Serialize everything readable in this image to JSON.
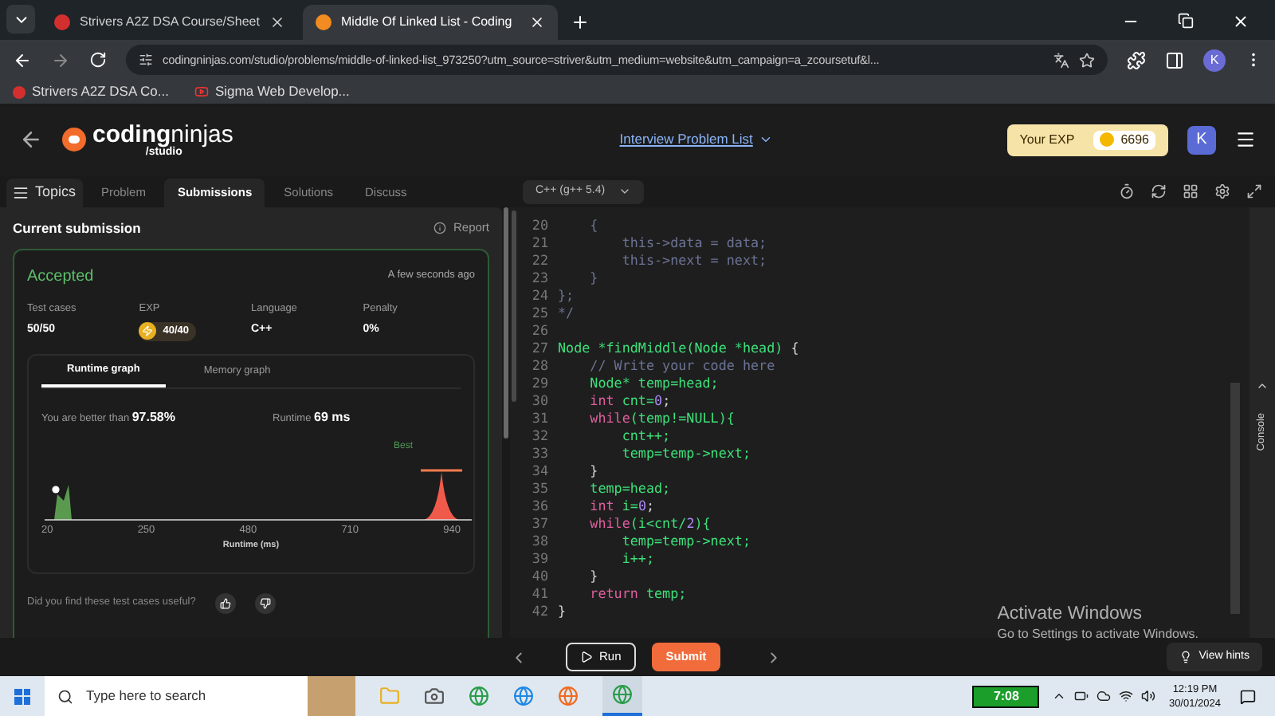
{
  "browser": {
    "tabs": [
      {
        "title": "Strivers A2Z DSA Course/Sheet",
        "selected": false
      },
      {
        "title": "Middle Of Linked List - Coding",
        "selected": true
      }
    ],
    "url": "codingninjas.com/studio/problems/middle-of-linked-list_973250?utm_source=striver&utm_medium=website&utm_campaign=a_zcoursetuf&l...",
    "profile": "K",
    "bookmarks": [
      "Strivers A2Z DSA Co...",
      "Sigma Web Develop..."
    ]
  },
  "header": {
    "logo_main": "coding",
    "logo_accent": "ninjas",
    "logo_sub": "/studio",
    "problem_list": "Interview Problem List",
    "exp_label": "Your EXP",
    "exp_value": "6696",
    "avatar": "K"
  },
  "topics": "Topics",
  "tabs": [
    {
      "label": "Problem",
      "selected": false
    },
    {
      "label": "Submissions",
      "selected": true
    },
    {
      "label": "Solutions",
      "selected": false
    },
    {
      "label": "Discuss",
      "selected": false
    }
  ],
  "submission": {
    "title": "Current submission",
    "report": "Report",
    "status": "Accepted",
    "time": "A few seconds ago",
    "stats": [
      {
        "label": "Test cases",
        "value": "50/50",
        "kind": "text"
      },
      {
        "label": "EXP",
        "value": "40/40",
        "kind": "exp"
      },
      {
        "label": "Language",
        "value": "C++",
        "kind": "text"
      },
      {
        "label": "Penalty",
        "value": "0%",
        "kind": "text"
      }
    ],
    "graph_tabs": [
      {
        "label": "Runtime graph",
        "selected": true
      },
      {
        "label": "Memory graph",
        "selected": false
      }
    ],
    "better": "You are better than **97.58%**",
    "runtime": "Runtime **69 ms**",
    "best": "Best",
    "x_ticks": [
      "20",
      "250",
      "480",
      "710",
      "940"
    ],
    "x_label": "Runtime (ms)",
    "feedback": "Did you find these test cases useful?"
  },
  "editor": {
    "language": "C++ (g++ 5.4)",
    "lines": [
      {
        "number": "20",
        "tokens": [
          {
            "kind": "comment",
            "text": "    {"
          }
        ]
      },
      {
        "number": "21",
        "tokens": [
          {
            "kind": "comment",
            "text": "        this->data = data;"
          }
        ]
      },
      {
        "number": "22",
        "tokens": [
          {
            "kind": "comment",
            "text": "        this->next = next;"
          }
        ]
      },
      {
        "number": "23",
        "tokens": [
          {
            "kind": "comment",
            "text": "    }"
          }
        ]
      },
      {
        "number": "24",
        "tokens": [
          {
            "kind": "comment",
            "text": "};"
          }
        ]
      },
      {
        "number": "25",
        "tokens": [
          {
            "kind": "comment",
            "text": "*/"
          }
        ]
      },
      {
        "number": "26"
      },
      {
        "number": "27",
        "tokens": [
          {
            "kind": "ident",
            "text": "Node *findMiddle(Node *head) "
          },
          {
            "kind": "punct",
            "text": "{"
          }
        ]
      },
      {
        "number": "28",
        "tokens": [
          {
            "kind": "comment",
            "text": "    // Write your code here"
          }
        ]
      },
      {
        "number": "29",
        "tokens": [
          {
            "kind": "ident",
            "text": "    Node* temp=head;"
          }
        ]
      },
      {
        "number": "30",
        "tokens": [
          {
            "kind": "keyword",
            "text": "    int "
          },
          {
            "kind": "ident",
            "text": "cnt="
          },
          {
            "kind": "number",
            "text": "0"
          },
          {
            "kind": "punct",
            "text": ";"
          }
        ]
      },
      {
        "number": "31",
        "tokens": [
          {
            "kind": "keyword",
            "text": "    while"
          },
          {
            "kind": "ident",
            "text": "(temp!=NULL){"
          }
        ]
      },
      {
        "number": "32",
        "tokens": [
          {
            "kind": "ident",
            "text": "        cnt++;"
          }
        ]
      },
      {
        "number": "33",
        "tokens": [
          {
            "kind": "ident",
            "text": "        temp=temp->next;"
          }
        ]
      },
      {
        "number": "34",
        "tokens": [
          {
            "kind": "punct",
            "text": "    }"
          }
        ]
      },
      {
        "number": "35",
        "tokens": [
          {
            "kind": "ident",
            "text": "    temp=head;"
          }
        ]
      },
      {
        "number": "36",
        "tokens": [
          {
            "kind": "keyword",
            "text": "    int "
          },
          {
            "kind": "ident",
            "text": "i="
          },
          {
            "kind": "number",
            "text": "0"
          },
          {
            "kind": "punct",
            "text": ";"
          }
        ]
      },
      {
        "number": "37",
        "tokens": [
          {
            "kind": "keyword",
            "text": "    while"
          },
          {
            "kind": "ident",
            "text": "(i<cnt/"
          },
          {
            "kind": "number",
            "text": "2"
          },
          {
            "kind": "ident",
            "text": "){"
          }
        ]
      },
      {
        "number": "38",
        "tokens": [
          {
            "kind": "ident",
            "text": "        temp=temp->next;"
          }
        ]
      },
      {
        "number": "39",
        "tokens": [
          {
            "kind": "ident",
            "text": "        i++;"
          }
        ]
      },
      {
        "number": "40",
        "tokens": [
          {
            "kind": "punct",
            "text": "    }"
          }
        ]
      },
      {
        "number": "41",
        "tokens": [
          {
            "kind": "keyword",
            "text": "    return "
          },
          {
            "kind": "ident",
            "text": "temp;"
          }
        ]
      },
      {
        "number": "42",
        "tokens": [
          {
            "kind": "punct",
            "text": "}"
          }
        ]
      }
    ],
    "console": "Console"
  },
  "footer": {
    "run": "Run",
    "submit": "Submit",
    "hints": "View hints"
  },
  "activation": {
    "title": "Activate Windows",
    "subtitle": "Go to Settings to activate Windows."
  },
  "taskbar": {
    "search_placeholder": "Type here to search",
    "battery": "7:08",
    "time": "12:19 PM",
    "date": "30/01/2024"
  }
}
